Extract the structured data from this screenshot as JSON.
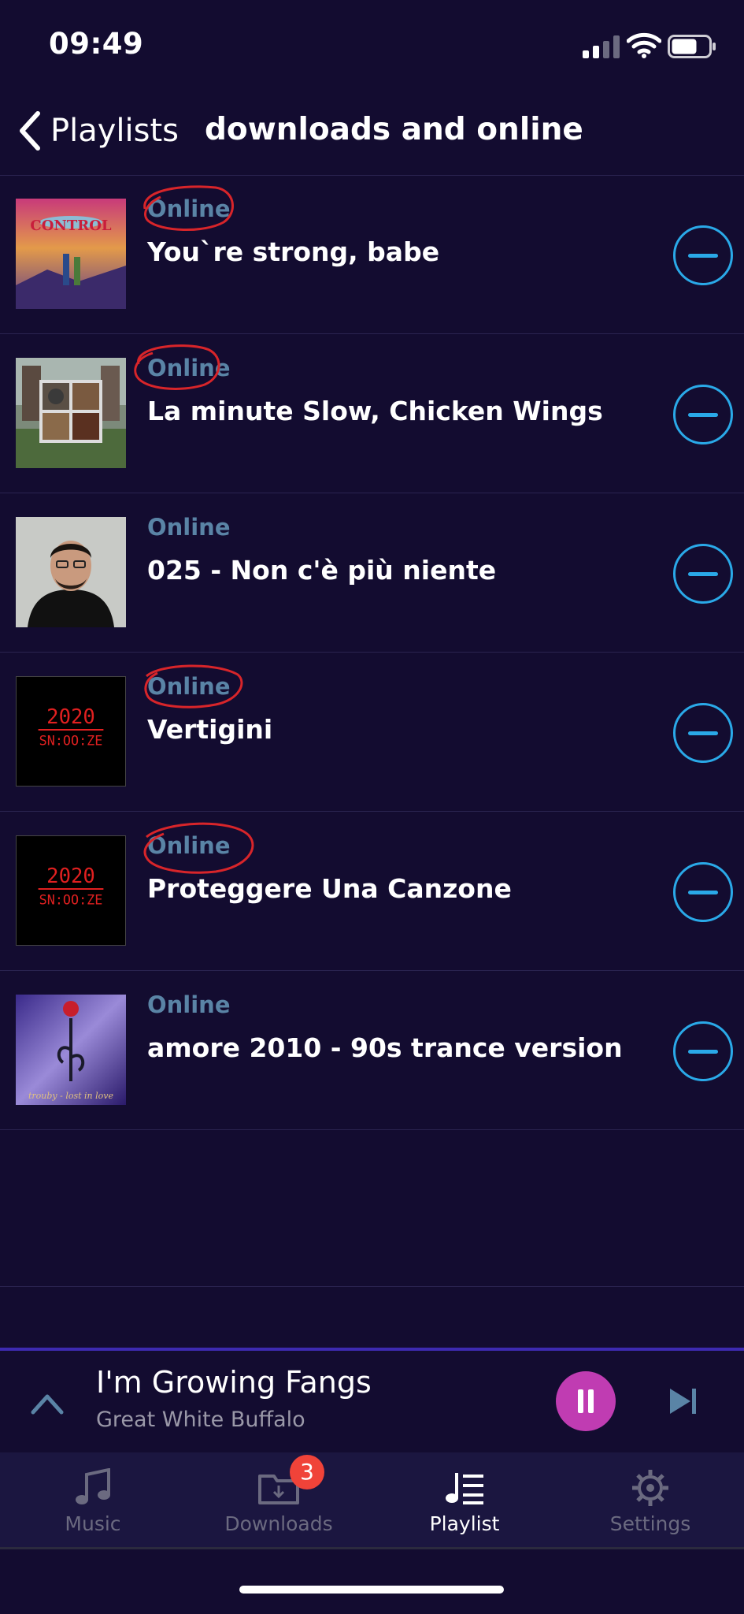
{
  "status_bar": {
    "time": "09:49",
    "battery_level": 0.7,
    "signal_bars": 2
  },
  "nav": {
    "back_label": "Playlists",
    "title": "downloads and online"
  },
  "tracks": [
    {
      "status": "Online",
      "title": "You`re strong, babe",
      "art_text": "CONTROL"
    },
    {
      "status": "Online",
      "title": "La minute Slow, Chicken Wings"
    },
    {
      "status": "Online",
      "title": "025 - Non c'è più niente"
    },
    {
      "status": "Online",
      "title": "Vertigini",
      "art_text": [
        "2020",
        "SN:OO:ZE"
      ]
    },
    {
      "status": "Online",
      "title": "Proteggere Una Canzone",
      "art_text": [
        "2020",
        "SN:OO:ZE"
      ]
    },
    {
      "status": "Online",
      "title": "amore 2010 - 90s trance version",
      "art_text": "trouby - lost in love"
    }
  ],
  "now_playing": {
    "title": "I'm Growing Fangs",
    "artist": "Great White Buffalo"
  },
  "tabs": [
    {
      "label": "Music",
      "icon": "music-note-icon"
    },
    {
      "label": "Downloads",
      "icon": "download-folder-icon",
      "badge": "3"
    },
    {
      "label": "Playlist",
      "icon": "playlist-icon",
      "active": true
    },
    {
      "label": "Settings",
      "icon": "gear-icon"
    }
  ],
  "colors": {
    "background": "#130c30",
    "accent_blue": "#2aa9e8",
    "play_button": "#c03cb2",
    "status_text": "#5a84a6",
    "badge": "#f04339",
    "annotation_red": "#d8252a"
  }
}
